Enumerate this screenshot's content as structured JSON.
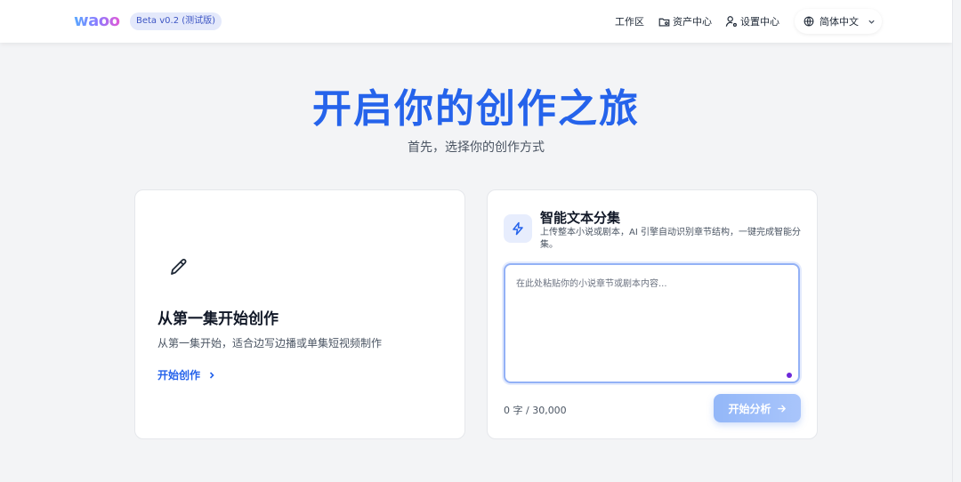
{
  "header": {
    "logo": "waoo",
    "beta_badge": "Beta v0.2 (测试版)",
    "nav": {
      "workspace": "工作区",
      "assets": "资产中心",
      "settings": "设置中心"
    },
    "language": "简体中文"
  },
  "hero": {
    "title": "开启你的创作之旅",
    "subtitle": "首先，选择你的创作方式"
  },
  "left_card": {
    "title": "从第一集开始创作",
    "description": "从第一集开始，适合边写边播或单集短视频制作",
    "link_label": "开始创作"
  },
  "right_card": {
    "title": "智能文本分集",
    "description": "上传整本小说或剧本，AI 引擎自动识别章节结构，一键完成智能分集。",
    "textarea": {
      "value": "",
      "placeholder": "在此处粘贴你的小说章节或剧本内容..."
    },
    "char_count": "0 字 / 30,000",
    "analyze_button": "开始分析"
  },
  "colors": {
    "accent": "#2563eb",
    "page_bg": "#f3f4f6",
    "button_disabled": "#a9c5fb"
  },
  "icons": [
    "folder-icon",
    "user-settings-icon",
    "globe-icon",
    "chevron-down-icon",
    "pencil-icon",
    "chevron-right-icon",
    "lightning-icon",
    "arrow-right-icon"
  ]
}
